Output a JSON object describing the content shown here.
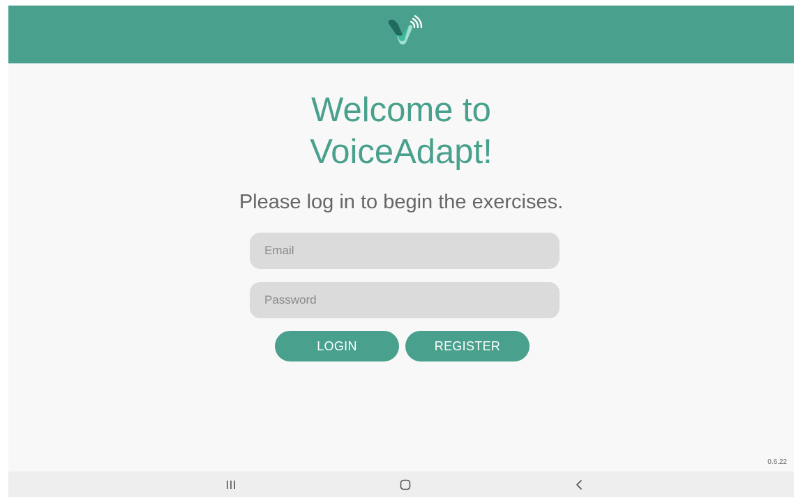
{
  "app": {
    "name": "VoiceAdapt",
    "logo_icon": "voiceadapt-logo-icon",
    "accent_color": "#48a08d"
  },
  "welcome": {
    "title_line1": "Welcome to",
    "title_line2": "VoiceAdapt!",
    "subtitle": "Please log in to begin the exercises."
  },
  "form": {
    "email_placeholder": "Email",
    "email_value": "",
    "password_placeholder": "Password",
    "password_value": "",
    "login_label": "LOGIN",
    "register_label": "REGISTER"
  },
  "footer": {
    "version": "0.6.22"
  },
  "nav_bar": {
    "recents_icon": "recents-icon",
    "home_icon": "home-icon",
    "back_icon": "back-icon"
  }
}
